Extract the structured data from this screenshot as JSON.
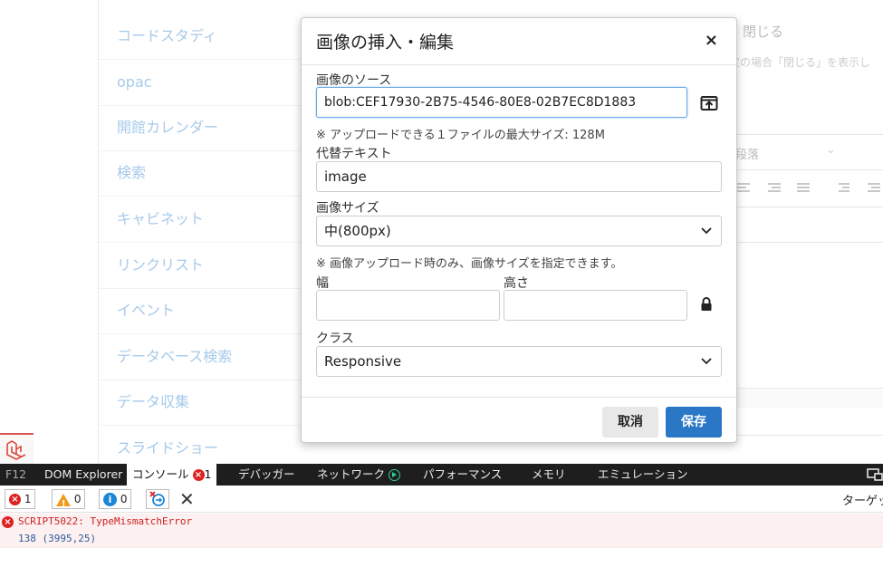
{
  "sidebar": {
    "items": [
      "コードスタディ",
      "opac",
      "開館カレンダー",
      "検索",
      "キャビネット",
      "リンクリスト",
      "イベント",
      "データベース検索",
      "データ収集",
      "スライドショー"
    ]
  },
  "background": {
    "close_link": "閉じる",
    "hint": "定の場合「閉じる」を表示し",
    "paragraph_select": "段落"
  },
  "modal": {
    "title": "画像の挿入・編集",
    "source_label": "画像のソース",
    "source_value": "blob:CEF17930-2B75-4546-80E8-02B7EC8D1883",
    "upload_note": "※ アップロードできる１ファイルの最大サイズ: 128M",
    "alt_label": "代替テキスト",
    "alt_value": "image",
    "size_label": "画像サイズ",
    "size_value": "中(800px)",
    "size_note": "※ 画像アップロード時のみ、画像サイズを指定できます。",
    "width_label": "幅",
    "height_label": "高さ",
    "width_value": "",
    "height_value": "",
    "class_label": "クラス",
    "class_value": "Responsive",
    "cancel_label": "取消",
    "save_label": "保存",
    "close_icon": "×"
  },
  "devtools": {
    "tabs": {
      "f12": "F12",
      "dom": "DOM Explorer",
      "console": "コンソール",
      "console_errors": "1",
      "debugger": "デバッガー",
      "network": "ネットワーク",
      "performance": "パフォーマンス",
      "memory": "メモリ",
      "emulation": "エミュレーション"
    },
    "filters": {
      "errors": "1",
      "warnings": "0",
      "info": "0"
    },
    "target_label": "ターゲッ",
    "console": {
      "error_code": "SCRIPT5022:",
      "error_message": "TypeMismatchError",
      "location": "138 (3995,25)"
    },
    "colors": {
      "error": "#d22222",
      "warning": "#f09a1a",
      "info": "#1b86d8",
      "primary": "#2a77c5"
    }
  }
}
